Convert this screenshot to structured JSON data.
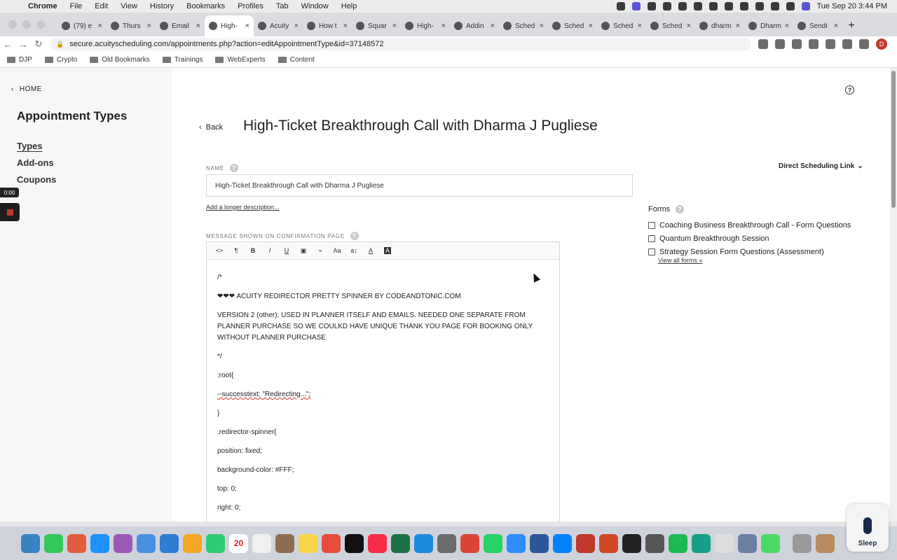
{
  "menubar": {
    "app": "Chrome",
    "items": [
      "File",
      "Edit",
      "View",
      "History",
      "Bookmarks",
      "Profiles",
      "Tab",
      "Window",
      "Help"
    ],
    "datetime": "Tue Sep 20  3:44 PM"
  },
  "tabs": [
    {
      "title": "(79) e",
      "fav": "linkedin-icon"
    },
    {
      "title": "Thurs",
      "fav": "acuity-icon"
    },
    {
      "title": "Email",
      "fav": "acuity-icon"
    },
    {
      "title": "High-",
      "fav": "acuity-icon",
      "active": true
    },
    {
      "title": "Acuity",
      "fav": "acuity-icon"
    },
    {
      "title": "How t",
      "fav": "generic-icon"
    },
    {
      "title": "Squar",
      "fav": "generic-icon"
    },
    {
      "title": "High-",
      "fav": "acuity-icon"
    },
    {
      "title": "Addin",
      "fav": "generic-icon"
    },
    {
      "title": "Sched",
      "fav": "generic-icon"
    },
    {
      "title": "Sched",
      "fav": "generic-icon"
    },
    {
      "title": "Sched",
      "fav": "acuity-icon"
    },
    {
      "title": "Sched",
      "fav": "acuity-icon"
    },
    {
      "title": "dharm",
      "fav": "docs-icon"
    },
    {
      "title": "Dharm",
      "fav": "docs-icon"
    },
    {
      "title": "Sendi",
      "fav": "generic-icon"
    }
  ],
  "address": {
    "url": "secure.acuityscheduling.com/appointments.php?action=editAppointmentType&id=37148572",
    "profile_initial": "D"
  },
  "bookmarks": [
    "DJP",
    "Crypto",
    "Old Bookmarks",
    "Trainings",
    "WebExperts",
    "Content"
  ],
  "sidebar": {
    "home": "HOME",
    "title": "Appointment Types",
    "items": [
      "Types",
      "Add-ons",
      "Coupons"
    ]
  },
  "main": {
    "back": "Back",
    "title": "High-Ticket Breakthrough Call with Dharma J Pugliese",
    "name_label": "NAME",
    "name_value": "High-Ticket Breakthrough Call with Dharma J Pugliese",
    "longer_desc": "Add a longer description...",
    "message_label": "MESSAGE SHOWN ON CONFIRMATION PAGE",
    "toolbar": [
      "<>",
      "¶",
      "B",
      "I",
      "U",
      "▣",
      "⌁",
      "Aa",
      "a↕",
      "A",
      "A"
    ],
    "content": [
      "/*",
      "❤❤❤ ACUITY REDIRECTOR PRETTY SPINNER BY CODEANDTONIC.COM",
      "VERSION 2 (other): USED IN PLANNER ITSELF AND EMAILS. NEEDED ONE SEPARATE FROM PLANNER PURCHASE SO WE COULKD HAVE UNIQUE THANK YOU PAGE FOR BOOKING ONLY WITHOUT PLANNER PURCHASE",
      "*/",
      ":root{",
      "--successtext: \"Redirecting...\";",
      "}",
      ".redirector-spinner{",
      "position: fixed;",
      "background-color: #FFF;",
      "top: 0;",
      "right: 0;"
    ]
  },
  "right_panel": {
    "direct_link": "Direct Scheduling Link",
    "forms_title": "Forms",
    "forms": [
      "Coaching Business Breakthrough Call - Form Questions",
      "Quantum Breakthrough Session",
      "Strategy Session Form Questions (Assessment)"
    ],
    "view_all": "View all forms »"
  },
  "recorder": {
    "time": "0:00"
  },
  "dock": {
    "calendar_day": "20"
  },
  "sleep_widget": {
    "label": "Sleep"
  },
  "colors": {
    "accent": "#222222",
    "sidebar_bg": "#f7f7f7",
    "record": "#c0392b"
  }
}
